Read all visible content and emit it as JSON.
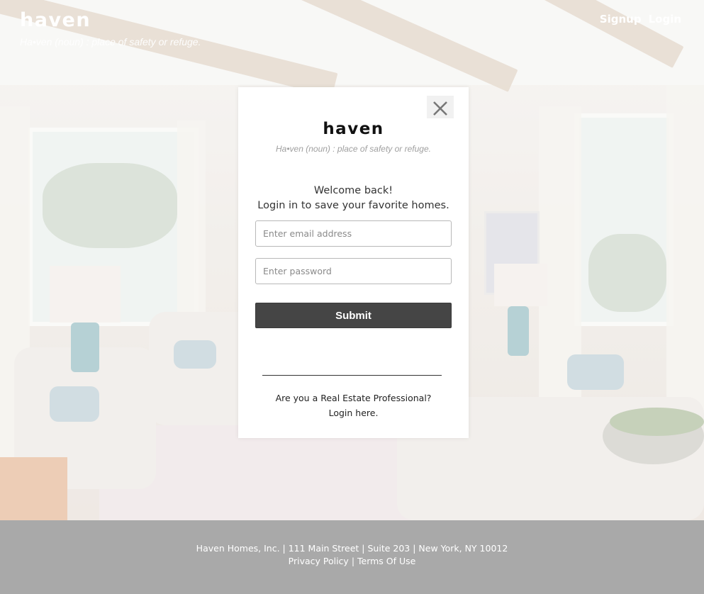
{
  "header": {
    "brand": "haven",
    "tagline": "Ha•ven (noun) : place of safety or refuge.",
    "nav": {
      "signup": "Signup",
      "login": "Login"
    }
  },
  "modal": {
    "close_icon": "close-icon",
    "brand": "haven",
    "tagline": "Ha•ven (noun) : place of safety or refuge.",
    "welcome_line1": "Welcome back!",
    "welcome_line2": "Login in to save your favorite homes.",
    "email_placeholder": "Enter email address",
    "email_value": "",
    "password_placeholder": "Enter password",
    "password_value": "",
    "submit_label": "Submit",
    "pro_question": "Are you a Real Estate Professional?",
    "pro_link": "Login here."
  },
  "footer": {
    "address": "Haven Homes, Inc. | 111 Main Street | Suite 203 | New York, NY 10012",
    "privacy": "Privacy Policy",
    "separator": "|",
    "terms": "Terms Of Use"
  },
  "colors": {
    "submit_bg": "#454545",
    "footer_bg": "#a9a9a9",
    "modal_bg": "#ffffff"
  }
}
